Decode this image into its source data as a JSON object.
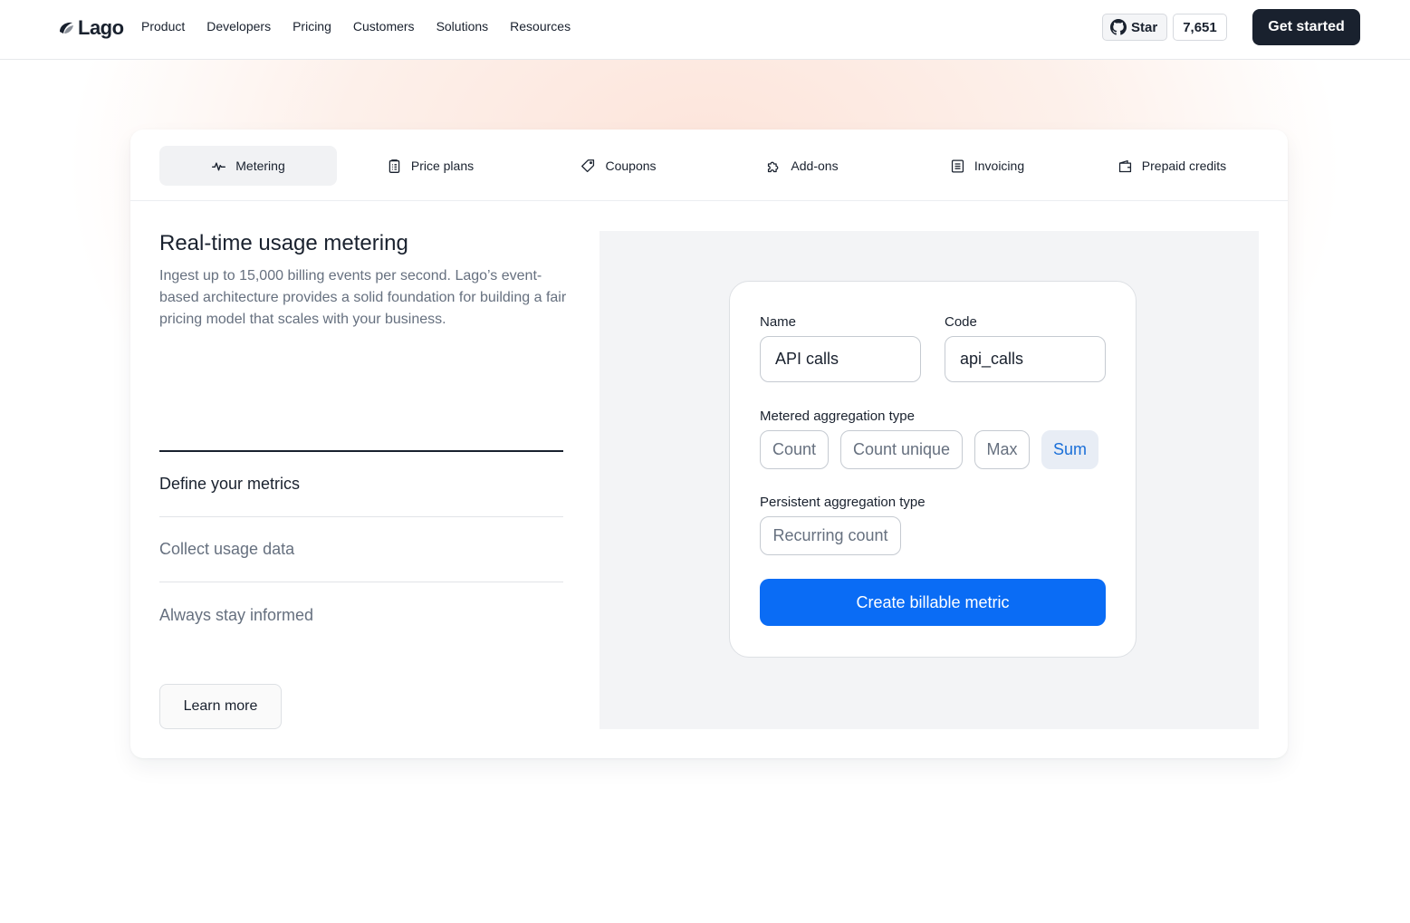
{
  "nav": {
    "logo_text": "Lago",
    "links": [
      "Product",
      "Developers",
      "Pricing",
      "Customers",
      "Solutions",
      "Resources"
    ],
    "github_star_label": "Star",
    "github_star_count": "7,651",
    "cta_label": "Get started"
  },
  "tabs": [
    {
      "label": "Metering",
      "icon": "activity-icon",
      "active": true
    },
    {
      "label": "Price plans",
      "icon": "clipboard-icon",
      "active": false
    },
    {
      "label": "Coupons",
      "icon": "tag-icon",
      "active": false
    },
    {
      "label": "Add-ons",
      "icon": "puzzle-icon",
      "active": false
    },
    {
      "label": "Invoicing",
      "icon": "document-icon",
      "active": false
    },
    {
      "label": "Prepaid credits",
      "icon": "wallet-icon",
      "active": false
    }
  ],
  "feature": {
    "title": "Real-time usage metering",
    "description": "Ingest up to 15,000 billing events per second. Lago’s event-based architecture provides a solid foundation for building a fair pricing model that scales with your business.",
    "steps": [
      "Define your metrics",
      "Collect usage data",
      "Always stay informed"
    ],
    "active_step": 0,
    "learn_more_label": "Learn more"
  },
  "form": {
    "name_label": "Name",
    "name_value": "API calls",
    "code_label": "Code",
    "code_value": "api_calls",
    "metered_label": "Metered aggregation type",
    "metered_options": [
      "Count",
      "Count unique",
      "Max",
      "Sum"
    ],
    "metered_selected": "Sum",
    "persistent_label": "Persistent aggregation type",
    "persistent_options": [
      "Recurring count"
    ],
    "submit_label": "Create billable metric"
  },
  "colors": {
    "primary_dark": "#19212e",
    "accent_blue": "#0a6cf5",
    "selected_chip_bg": "#e8edf5",
    "muted_text": "#66707f"
  }
}
